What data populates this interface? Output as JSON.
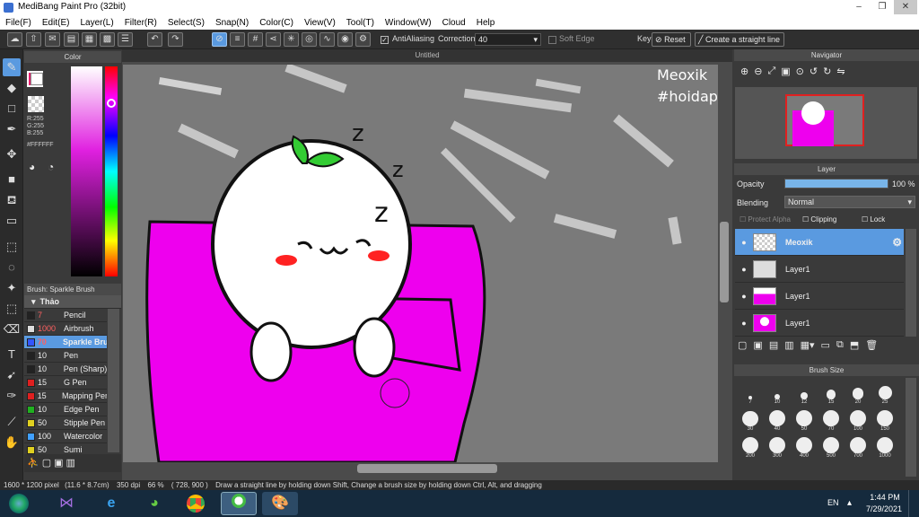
{
  "window": {
    "title": "MediBang Paint Pro (32bit)"
  },
  "menu": [
    "File(F)",
    "Edit(E)",
    "Layer(L)",
    "Filter(R)",
    "Select(S)",
    "Snap(N)",
    "Color(C)",
    "View(V)",
    "Tool(T)",
    "Window(W)",
    "Cloud",
    "Help"
  ],
  "toolbar": {
    "antialiasing_label": "AntiAliasing",
    "correction_label": "Correction",
    "correction_value": "40",
    "soft_edge_label": "Soft Edge",
    "key_label": "Key",
    "reset_label": "Reset",
    "straight_line_label": "Create a straight line"
  },
  "color_panel": {
    "title": "Color",
    "r": "R:255",
    "g": "G:255",
    "b": "B:255",
    "hex": "#FFFFFF"
  },
  "brush_panel": {
    "title": "Brush: Sparkle Brush",
    "group": "Thảo",
    "items": [
      {
        "size": "7",
        "name": "Pencil",
        "color": "#222222",
        "size_color": "#ff6060"
      },
      {
        "size": "1000",
        "name": "Airbrush",
        "color": "#dddddd",
        "size_color": "#ff6060"
      },
      {
        "size": "70",
        "name": "Sparkle Bru",
        "color": "#3355ff",
        "size_color": "#ff6060"
      },
      {
        "size": "10",
        "name": "Pen",
        "color": "#222222",
        "size_color": "#eeeeee"
      },
      {
        "size": "10",
        "name": "Pen (Sharp)",
        "color": "#222222",
        "size_color": "#eeeeee"
      },
      {
        "size": "15",
        "name": "G Pen",
        "color": "#e02020",
        "size_color": "#eeeeee"
      },
      {
        "size": "15",
        "name": "Mapping Pen",
        "color": "#e02020",
        "size_color": "#eeeeee"
      },
      {
        "size": "10",
        "name": "Edge Pen",
        "color": "#20b020",
        "size_color": "#eeeeee"
      },
      {
        "size": "50",
        "name": "Stipple Pen",
        "color": "#e0d020",
        "size_color": "#eeeeee"
      },
      {
        "size": "100",
        "name": "Watercolor",
        "color": "#40a0ff",
        "size_color": "#eeeeee"
      },
      {
        "size": "50",
        "name": "Sumi",
        "color": "#e0d020",
        "size_color": "#eeeeee"
      }
    ]
  },
  "canvas": {
    "tab": "Untitled",
    "watermark_1": "Meoxik",
    "watermark_2": "#hoidap"
  },
  "navigator": {
    "title": "Navigator"
  },
  "layer_panel": {
    "title": "Layer",
    "opacity_label": "Opacity",
    "opacity_value": "100 %",
    "opacity_fraction": 1.0,
    "blending_label": "Blending",
    "blending_value": "Normal",
    "protect_alpha": "Protect Alpha",
    "clipping": "Clipping",
    "lock": "Lock",
    "layers": [
      {
        "name": "Meoxik",
        "selected": true
      },
      {
        "name": "Layer1",
        "selected": false
      },
      {
        "name": "Layer1",
        "selected": false
      },
      {
        "name": "Layer1",
        "selected": false
      }
    ]
  },
  "brush_size": {
    "title": "Brush Size",
    "sizes": [
      "7",
      "10",
      "12",
      "15",
      "20",
      "25",
      "30",
      "40",
      "50",
      "70",
      "100",
      "150",
      "200",
      "300",
      "400",
      "500",
      "700",
      "1000"
    ]
  },
  "status": {
    "dims": "1600 * 1200 pixel",
    "cm": "(11.6 * 8.7cm)",
    "dpi": "350 dpi",
    "zoom": "66 %",
    "coords": "( 728, 900 )",
    "hint": "Draw a straight line by holding down Shift, Change a brush size by holding down Ctrl, Alt, and dragging"
  },
  "taskbar": {
    "lang": "EN",
    "time": "1:44 PM",
    "date": "7/29/2021"
  }
}
